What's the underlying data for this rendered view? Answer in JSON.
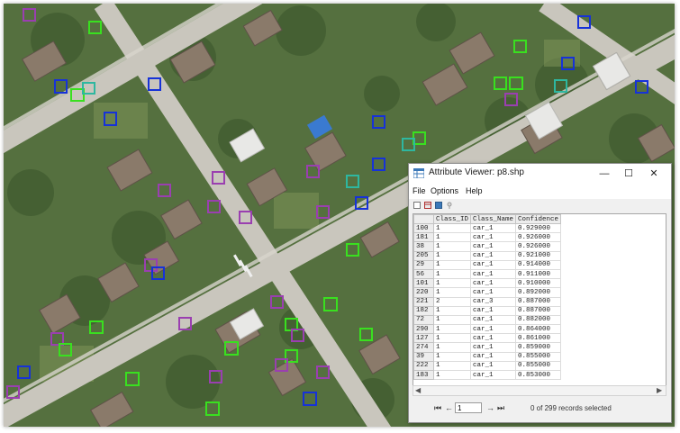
{
  "window": {
    "title": "Attribute Viewer: p8.shp",
    "controls": {
      "minimize": "—",
      "maximize": "☐",
      "close": "✕"
    }
  },
  "menu": [
    "File",
    "Options",
    "Help"
  ],
  "table": {
    "columns": [
      "",
      "Class_ID",
      "Class_Name",
      "Confidence"
    ],
    "rows": [
      [
        "100",
        "1",
        "car_1",
        "0.929000"
      ],
      [
        "181",
        "1",
        "car_1",
        "0.926000"
      ],
      [
        "38",
        "1",
        "car_1",
        "0.926000"
      ],
      [
        "205",
        "1",
        "car_1",
        "0.921000"
      ],
      [
        "29",
        "1",
        "car_1",
        "0.914000"
      ],
      [
        "56",
        "1",
        "car_1",
        "0.911000"
      ],
      [
        "101",
        "1",
        "car_1",
        "0.910000"
      ],
      [
        "220",
        "1",
        "car_1",
        "0.892000"
      ],
      [
        "221",
        "2",
        "car_3",
        "0.887000"
      ],
      [
        "182",
        "1",
        "car_1",
        "0.887000"
      ],
      [
        "72",
        "1",
        "car_1",
        "0.882000"
      ],
      [
        "290",
        "1",
        "car_1",
        "0.864000"
      ],
      [
        "127",
        "1",
        "car_1",
        "0.861000"
      ],
      [
        "274",
        "1",
        "car_1",
        "0.859000"
      ],
      [
        "39",
        "1",
        "car_1",
        "0.855000"
      ],
      [
        "222",
        "1",
        "car_1",
        "0.855000"
      ],
      [
        "183",
        "1",
        "car_1",
        "0.853000"
      ]
    ]
  },
  "navigation": {
    "first": "⏮",
    "prev": "←",
    "next": "→",
    "last": "⏭",
    "record_value": "1",
    "status": "0 of 299 records selected"
  },
  "colors": {
    "box_green": "#39e01f",
    "box_purple": "#9a3fb0",
    "box_blue": "#1632d8",
    "box_teal": "#2eb7a0"
  }
}
